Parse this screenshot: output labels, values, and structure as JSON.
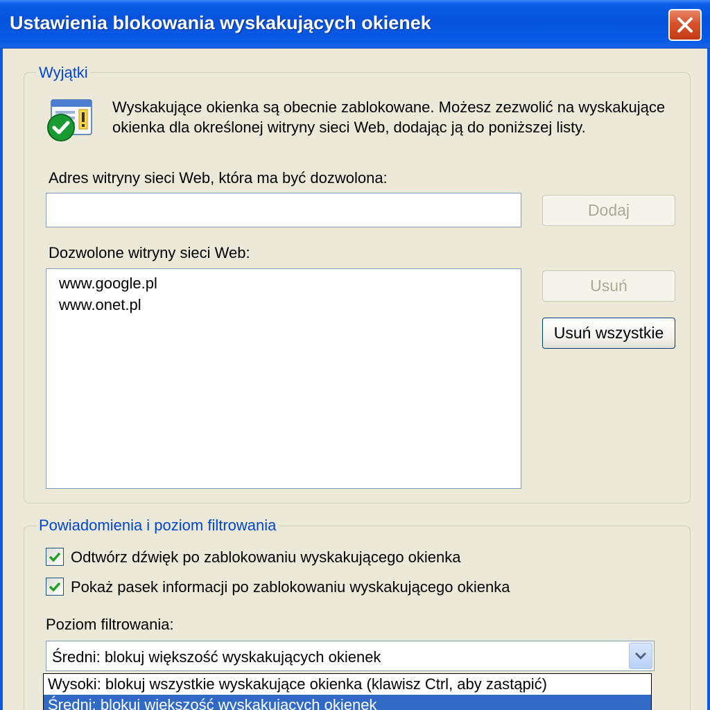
{
  "window": {
    "title": "Ustawienia blokowania wyskakujących okienek"
  },
  "exceptions": {
    "legend": "Wyjątki",
    "info": "Wyskakujące okienka są obecnie zablokowane. Możesz zezwolić na wyskakujące okienka dla określonej witryny sieci Web, dodając ją do poniższej listy.",
    "address_label": "Adres witryny sieci Web, która ma być dozwolona:",
    "address_value": "",
    "add_label": "Dodaj",
    "allowed_label": "Dozwolone witryny sieci Web:",
    "allowed_sites": [
      "www.google.pl",
      "www.onet.pl"
    ],
    "remove_label": "Usuń",
    "remove_all_label": "Usuń wszystkie"
  },
  "notifications": {
    "legend": "Powiadomienia i poziom filtrowania",
    "play_sound_label": "Odtwórz dźwięk po zablokowaniu wyskakującego okienka",
    "play_sound_checked": true,
    "show_infobar_label": "Pokaż pasek informacji po zablokowaniu wyskakującego okienka",
    "show_infobar_checked": true,
    "filter_level_label": "Poziom filtrowania:",
    "filter_level_selected": "Średni: blokuj większość wyskakujących okienek",
    "filter_level_options": [
      "Wysoki: blokuj wszystkie wyskakujące okienka (klawisz Ctrl, aby zastąpić)",
      "Średni: blokuj większość wyskakujących okienek"
    ]
  },
  "colors": {
    "titlebar": "#0a5ae6",
    "legend_text": "#0046d5",
    "selection": "#316ac5"
  }
}
